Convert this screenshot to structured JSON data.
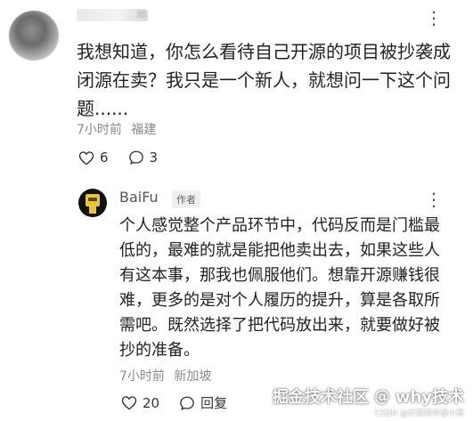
{
  "main_comment": {
    "text": "我想知道，你怎么看待自己开源的项目被抄袭成闭源在卖？我只是一个新人，就想问一下这个问题......",
    "time": "7小时前",
    "location": "福建",
    "likes": "6",
    "replies": "3",
    "more_icon": "⋮"
  },
  "reply": {
    "username": "BaiFu",
    "badge": "作者",
    "text": "个人感觉整个产品环节中，代码反而是门槛最低的，最难的就是能把他卖出去，如果这些人有这本事，那我也佩服他们。想靠开源赚钱很难，更多的是对个人履历的提升，算是各取所需吧。既然选择了把代码放出来，就要做好被抄的准备。",
    "time": "7小时前",
    "location": "新加坡",
    "likes": "20",
    "reply_label": "回复",
    "more_icon": "⋮"
  },
  "watermark": {
    "left": "掘金技术社区",
    "at": "@",
    "right": "why技术",
    "csdn": "CSDN @计算机毕设小哥"
  }
}
